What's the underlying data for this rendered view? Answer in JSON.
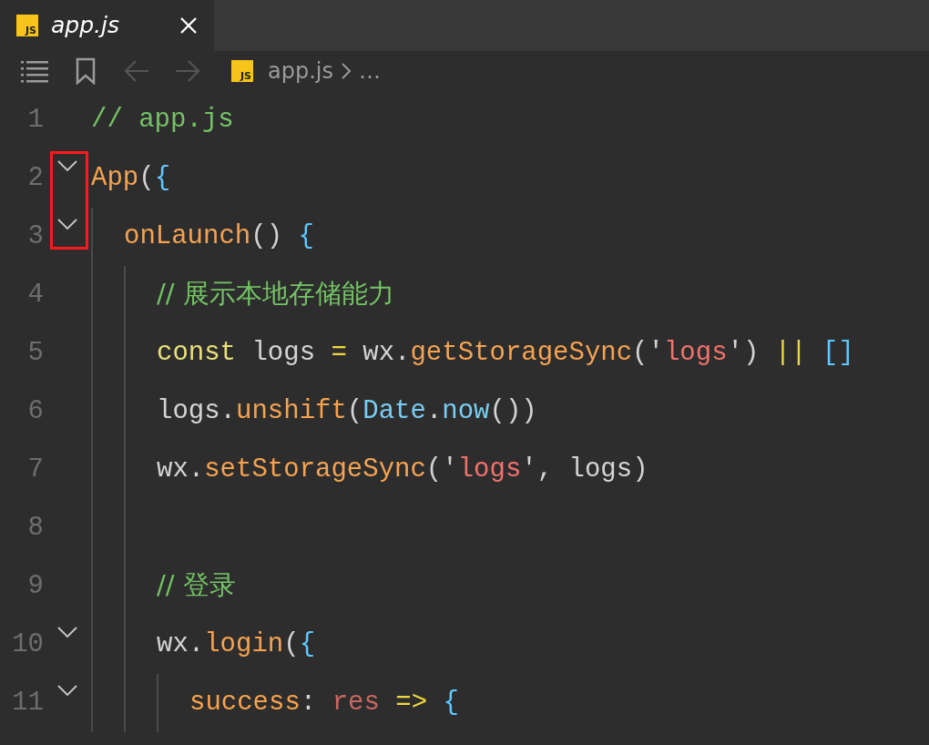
{
  "tabs": [
    {
      "label": "app.js",
      "icon_text": "JS",
      "selected": true,
      "preview": true
    }
  ],
  "toolbar": [
    {
      "kind": "outline",
      "disabled": false
    },
    {
      "kind": "bookmark",
      "disabled": false
    },
    {
      "kind": "back",
      "disabled": true
    },
    {
      "kind": "forward",
      "disabled": true
    }
  ],
  "breadcrumb": {
    "icon_text": "JS",
    "file": "app.js",
    "more": "…"
  },
  "lines": [
    {
      "number": "1",
      "foldable": false,
      "highlighted": false,
      "tokens": [
        {
          "kind": "comment",
          "text": "// app.js"
        }
      ]
    },
    {
      "number": "2",
      "foldable": true,
      "highlighted": true,
      "tokens": [
        {
          "kind": "function",
          "text": "App"
        },
        {
          "kind": "paren",
          "text": "("
        },
        {
          "kind": "brace",
          "text": "{"
        }
      ],
      "children": [
        {
          "number": "3",
          "foldable": true,
          "highlighted": true,
          "tokens": [
            {
              "kind": "function",
              "text": "onLaunch"
            },
            {
              "kind": "paren",
              "text": "()"
            },
            {
              "kind": "brace",
              "text": " {"
            }
          ],
          "children": [
            {
              "number": "4",
              "foldable": false,
              "highlighted": false,
              "tokens": [
                {
                  "kind": "comment",
                  "text": "// 展示本地存储能力"
                }
              ]
            },
            {
              "number": "5",
              "foldable": false,
              "highlighted": false,
              "tokens": [
                {
                  "kind": "keyword",
                  "text": "const"
                },
                {
                  "kind": "plain",
                  "text": " logs "
                },
                {
                  "kind": "operator",
                  "text": "="
                },
                {
                  "kind": "plain",
                  "text": " wx."
                },
                {
                  "kind": "function",
                  "text": "getStorageSync"
                },
                {
                  "kind": "paren",
                  "text": "("
                },
                {
                  "kind": "plain",
                  "text": "'"
                },
                {
                  "kind": "string",
                  "text": "logs"
                },
                {
                  "kind": "plain",
                  "text": "'"
                },
                {
                  "kind": "paren",
                  "text": ") "
                },
                {
                  "kind": "operator",
                  "text": "||"
                },
                {
                  "kind": "brace",
                  "text": " []"
                }
              ]
            },
            {
              "number": "6",
              "foldable": false,
              "highlighted": false,
              "tokens": [
                {
                  "kind": "plain",
                  "text": "logs."
                },
                {
                  "kind": "function",
                  "text": "unshift"
                },
                {
                  "kind": "paren",
                  "text": "("
                },
                {
                  "kind": "class",
                  "text": "Date"
                },
                {
                  "kind": "plain",
                  "text": "."
                },
                {
                  "kind": "class",
                  "text": "now"
                },
                {
                  "kind": "paren",
                  "text": "())"
                }
              ]
            },
            {
              "number": "7",
              "foldable": false,
              "highlighted": false,
              "tokens": [
                {
                  "kind": "plain",
                  "text": "wx."
                },
                {
                  "kind": "function",
                  "text": "setStorageSync"
                },
                {
                  "kind": "paren",
                  "text": "("
                },
                {
                  "kind": "plain",
                  "text": "'"
                },
                {
                  "kind": "string",
                  "text": "logs"
                },
                {
                  "kind": "plain",
                  "text": "', logs"
                },
                {
                  "kind": "paren",
                  "text": ")"
                }
              ]
            },
            {
              "number": "8",
              "foldable": false,
              "highlighted": false
            },
            {
              "number": "9",
              "foldable": false,
              "highlighted": false,
              "tokens": [
                {
                  "kind": "comment",
                  "text": "// 登录"
                }
              ]
            },
            {
              "number": "10",
              "foldable": true,
              "highlighted": false,
              "tokens": [
                {
                  "kind": "plain",
                  "text": "wx."
                },
                {
                  "kind": "function",
                  "text": "login"
                },
                {
                  "kind": "paren",
                  "text": "("
                },
                {
                  "kind": "brace",
                  "text": "{"
                }
              ],
              "children": [
                {
                  "number": "11",
                  "foldable": true,
                  "highlighted": false,
                  "tokens": [
                    {
                      "kind": "function",
                      "text": "success"
                    },
                    {
                      "kind": "plain",
                      "text": ": "
                    },
                    {
                      "kind": "parameter",
                      "text": "res"
                    },
                    {
                      "kind": "operator",
                      "text": " =>"
                    },
                    {
                      "kind": "brace",
                      "text": " {"
                    }
                  ]
                }
              ]
            }
          ]
        }
      ]
    }
  ]
}
